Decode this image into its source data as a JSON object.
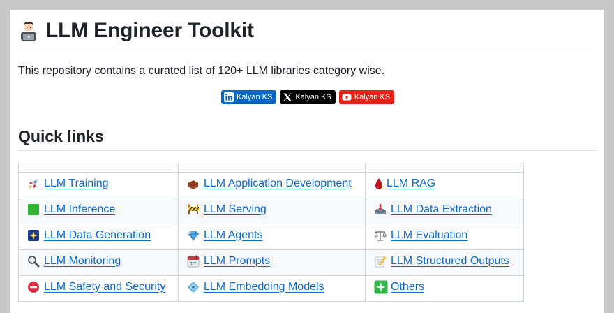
{
  "header": {
    "title": "LLM Engineer Toolkit",
    "title_icon": "technologist-laptop-emoji"
  },
  "intro": {
    "text": "This repository contains a curated list of 120+ LLM libraries category wise."
  },
  "badges": [
    {
      "label": "Kalyan KS",
      "icon": "linkedin-icon",
      "color": "#0a66c2"
    },
    {
      "label": "Kalyan KS",
      "icon": "x-icon",
      "color": "#000000"
    },
    {
      "label": "Kalyan KS",
      "icon": "youtube-icon",
      "color": "#e62117"
    }
  ],
  "quick_links": {
    "heading": "Quick links",
    "rows": [
      [
        {
          "label": "LLM Training",
          "icon": "rocket-icon"
        },
        {
          "label": "LLM Application Development",
          "icon": "bricks-icon"
        },
        {
          "label": "LLM RAG",
          "icon": "droplet-icon"
        }
      ],
      [
        {
          "label": "LLM Inference",
          "icon": "green-square-icon"
        },
        {
          "label": "LLM Serving",
          "icon": "construction-icon"
        },
        {
          "label": "LLM Data Extraction",
          "icon": "inbox-tray-icon"
        }
      ],
      [
        {
          "label": "LLM Data Generation",
          "icon": "sparkle-picture-icon"
        },
        {
          "label": "LLM Agents",
          "icon": "gem-icon"
        },
        {
          "label": "LLM Evaluation",
          "icon": "scales-icon"
        }
      ],
      [
        {
          "label": "LLM Monitoring",
          "icon": "magnifier-icon"
        },
        {
          "label": "LLM Prompts",
          "icon": "calendar-icon"
        },
        {
          "label": "LLM Structured Outputs",
          "icon": "memo-icon"
        }
      ],
      [
        {
          "label": "LLM Safety and Security",
          "icon": "red-circle-icon"
        },
        {
          "label": "LLM Embedding Models",
          "icon": "diamond-icon"
        },
        {
          "label": "Others",
          "icon": "sparkles-icon"
        }
      ]
    ]
  },
  "colors": {
    "link": "#0969da",
    "background": "#c8c8c8",
    "row_shade": "#f6f8fa"
  }
}
